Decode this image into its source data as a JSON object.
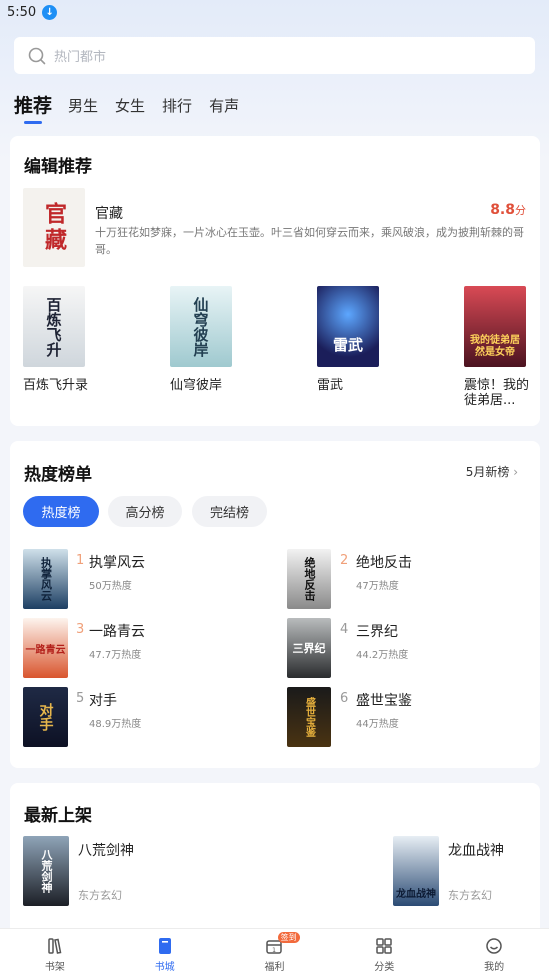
{
  "status": {
    "time": "5:50"
  },
  "search": {
    "placeholder": "热门都市"
  },
  "tabs": [
    {
      "label": "推荐"
    },
    {
      "label": "男生"
    },
    {
      "label": "女生"
    },
    {
      "label": "排行"
    },
    {
      "label": "有声"
    }
  ],
  "editor": {
    "title": "编辑推荐",
    "featured": {
      "title": "官藏",
      "score": "8.8",
      "score_unit": "分",
      "desc": "十万狂花如梦寐，一片冰心在玉壶。叶三省如何穿云而来，乘风破浪，成为披荆斩棘的哥哥。",
      "cover_text": "官藏"
    },
    "books": [
      {
        "title": "百炼飞升录",
        "cover_text": "百炼飞升"
      },
      {
        "title": "仙穹彼岸",
        "cover_text": "仙穹彼岸"
      },
      {
        "title": "雷武",
        "cover_text": "雷武"
      },
      {
        "title": "震惊！我的徒弟居...",
        "cover_text": "我的徒弟居然是女帝"
      }
    ]
  },
  "hot": {
    "title": "热度榜单",
    "more": "5月新榜",
    "filters": [
      {
        "label": "热度榜"
      },
      {
        "label": "高分榜"
      },
      {
        "label": "完结榜"
      }
    ],
    "items": [
      {
        "rank": "1",
        "title": "执掌风云",
        "heat": "50万热度",
        "cover_text": "执掌风云"
      },
      {
        "rank": "2",
        "title": "绝地反击",
        "heat": "47万热度",
        "cover_text": "绝地反击"
      },
      {
        "rank": "3",
        "title": "一路青云",
        "heat": "47.7万热度",
        "cover_text": "一路青云"
      },
      {
        "rank": "4",
        "title": "三界纪",
        "heat": "44.2万热度",
        "cover_text": "三界纪"
      },
      {
        "rank": "5",
        "title": "对手",
        "heat": "48.9万热度",
        "cover_text": "对手"
      },
      {
        "rank": "6",
        "title": "盛世宝鉴",
        "heat": "44万热度",
        "cover_text": "盛世宝鉴"
      }
    ]
  },
  "latest": {
    "title": "最新上架",
    "items": [
      {
        "title": "八荒剑神",
        "genre": "东方玄幻",
        "cover_text": "八荒剑神"
      },
      {
        "title": "龙血战神",
        "genre": "东方玄幻",
        "cover_text": "龙血战神"
      }
    ]
  },
  "nav": {
    "items": [
      {
        "label": "书架"
      },
      {
        "label": "书城"
      },
      {
        "label": "福利"
      },
      {
        "label": "分类"
      },
      {
        "label": "我的"
      }
    ],
    "welfare_badge": "签到"
  },
  "colors": {
    "accent": "#2f6bf0",
    "score": "#e0503a"
  }
}
